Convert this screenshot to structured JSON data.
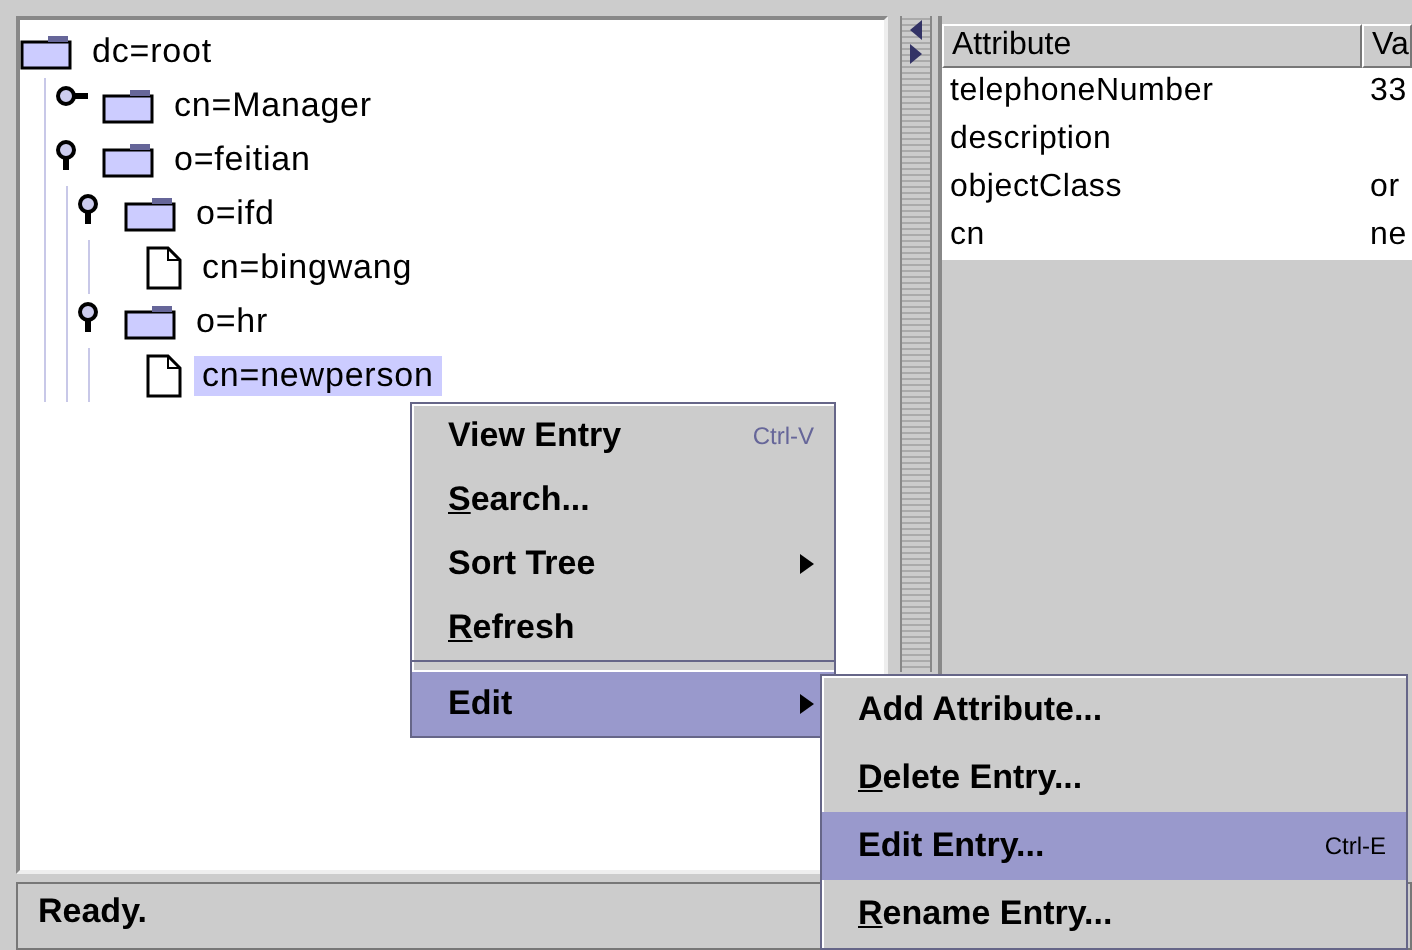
{
  "tree": {
    "label": "dc=root",
    "kind": "folder",
    "selected": false,
    "children": [
      {
        "label": "cn=Manager",
        "kind": "folder",
        "expanded": false,
        "selected": false
      },
      {
        "label": "o=feitian",
        "kind": "folder",
        "expanded": true,
        "selected": false,
        "children": [
          {
            "label": "o=ifd",
            "kind": "folder",
            "expanded": true,
            "selected": false,
            "children": [
              {
                "label": "cn=bingwang",
                "kind": "file",
                "selected": false
              }
            ]
          },
          {
            "label": "o=hr",
            "kind": "folder",
            "expanded": true,
            "selected": false,
            "children": [
              {
                "label": "cn=newperson",
                "kind": "file",
                "selected": true
              }
            ]
          }
        ]
      }
    ]
  },
  "table": {
    "columns": [
      "Attribute",
      "Va"
    ],
    "rows": [
      [
        "telephoneNumber",
        "33"
      ],
      [
        "description",
        ""
      ],
      [
        "objectClass",
        "or"
      ],
      [
        "cn",
        "ne"
      ]
    ]
  },
  "context_menu": {
    "items": [
      {
        "label": "View Entry",
        "shortcut": "Ctrl-V",
        "submenu": false,
        "selected": false,
        "mnemonic_first": false
      },
      {
        "label": "Search...",
        "submenu": false,
        "selected": false,
        "mnemonic_first": true
      },
      {
        "label": "Sort Tree",
        "submenu": true,
        "selected": false,
        "mnemonic_first": false
      },
      {
        "label": "Refresh",
        "submenu": false,
        "selected": false,
        "mnemonic_first": true
      },
      {
        "label": "Edit",
        "submenu": true,
        "selected": true,
        "mnemonic_first": false
      }
    ]
  },
  "submenu": {
    "items": [
      {
        "label": "Add Attribute...",
        "selected": false,
        "mnemonic_first": false
      },
      {
        "label": "Delete Entry...",
        "selected": false,
        "mnemonic_first": true
      },
      {
        "label": "Edit Entry...",
        "shortcut": "Ctrl-E",
        "selected": true,
        "mnemonic_first": false
      },
      {
        "label": "Rename Entry...",
        "selected": false,
        "mnemonic_first": true
      }
    ]
  },
  "status_bar": {
    "text": "Ready."
  }
}
